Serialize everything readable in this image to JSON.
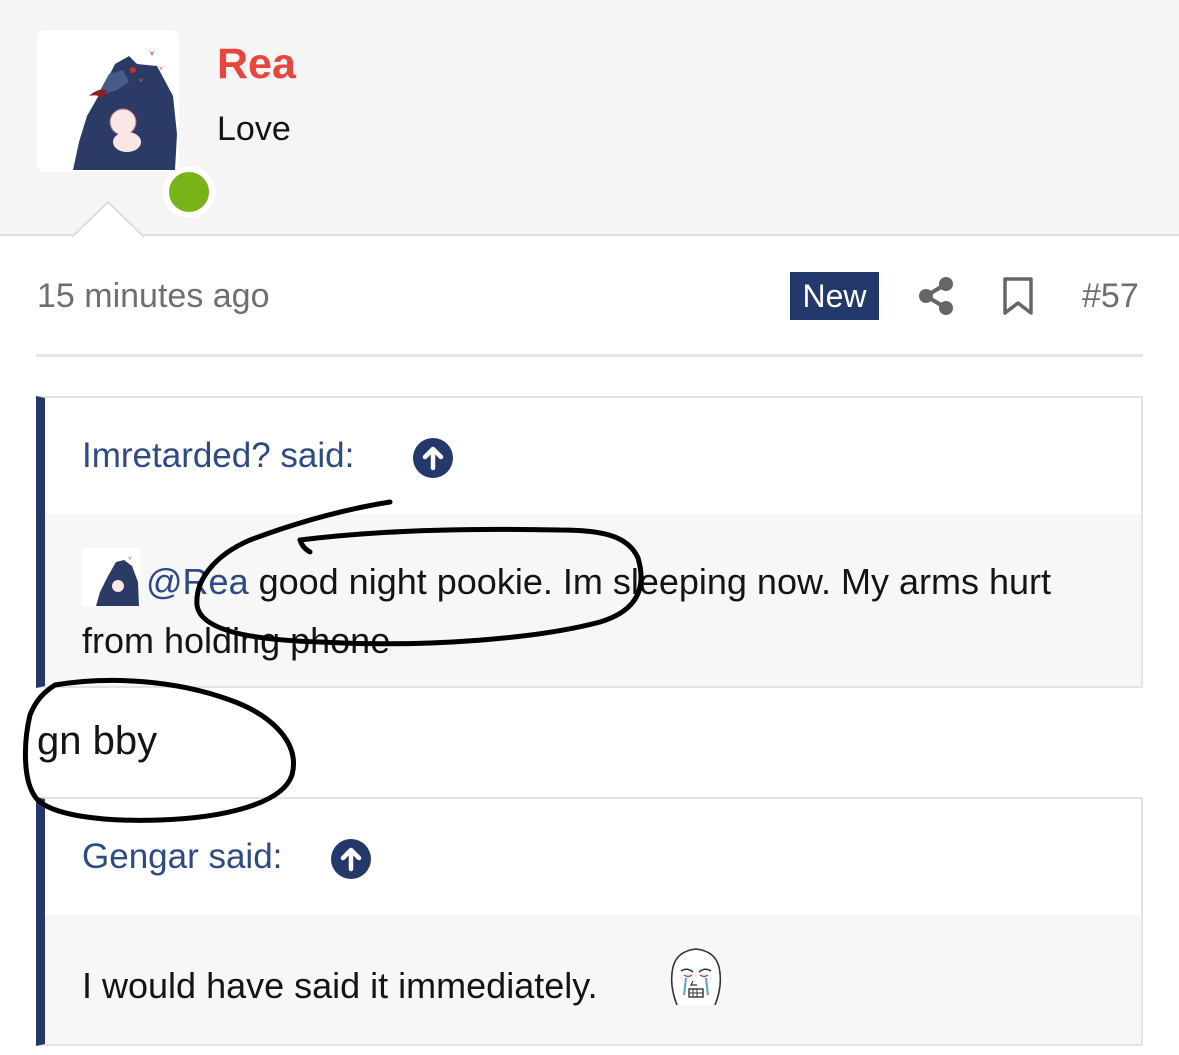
{
  "user": {
    "name": "Rea",
    "title": "Love",
    "online": true,
    "accent_color": "#e8453c",
    "online_color": "#7ab317"
  },
  "post": {
    "time": "15 minutes ago",
    "badge": "New",
    "number": "#57",
    "badge_color": "#23386b"
  },
  "quotes": [
    {
      "author": "Imretarded? said:",
      "mention": "@Rea",
      "text": " good night pookie. Im sleeping now. My arms hurt from holding phone"
    },
    {
      "author": "Gengar said:",
      "text": "I would have said it immediately."
    }
  ],
  "reply": "gn bby",
  "icons": [
    "share-icon",
    "bookmark-icon",
    "arrow-up-circle-icon",
    "crying-wojak-emoji"
  ]
}
